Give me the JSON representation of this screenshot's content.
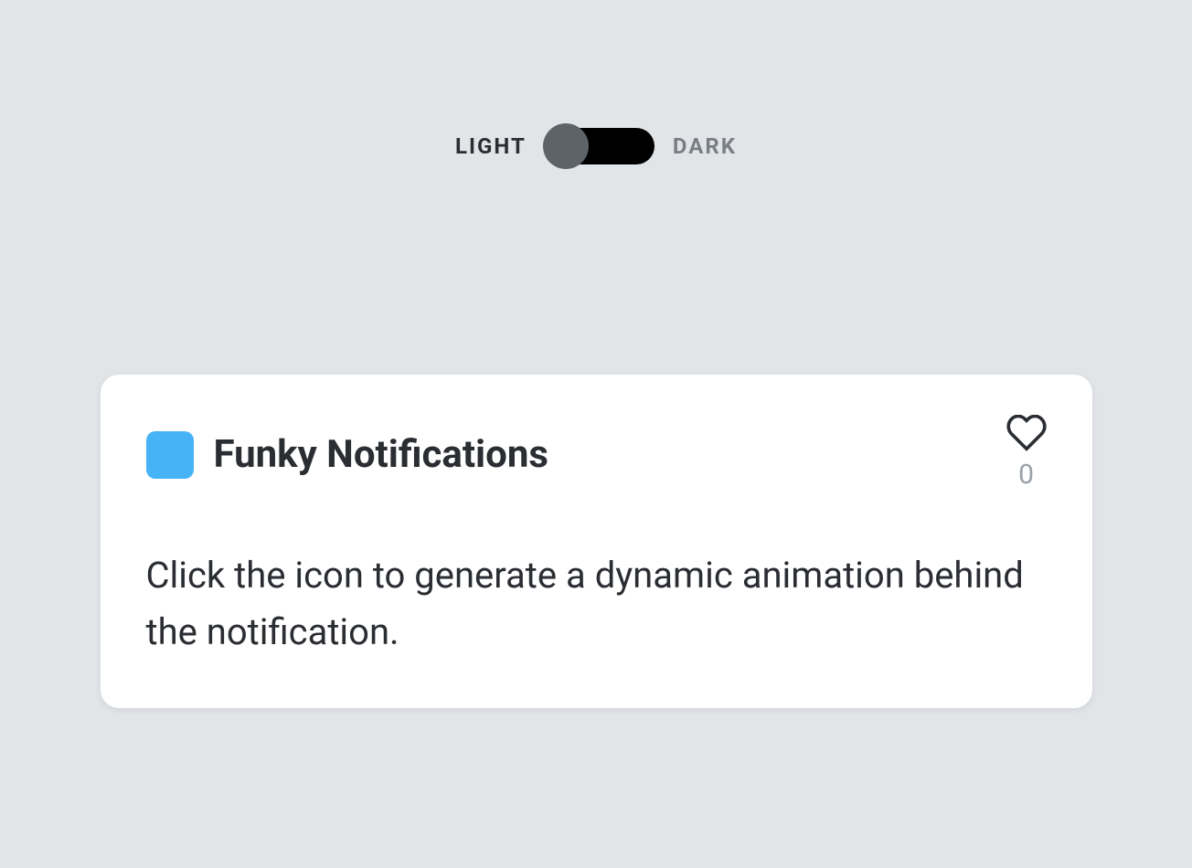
{
  "theme_toggle": {
    "light_label": "Light",
    "dark_label": "Dark",
    "active": "light"
  },
  "notification": {
    "title": "Funky Notifications",
    "description": "Click the icon to generate a dynamic animation behind the notification.",
    "heart_count": "0",
    "icon_color": "#47b3f7"
  }
}
